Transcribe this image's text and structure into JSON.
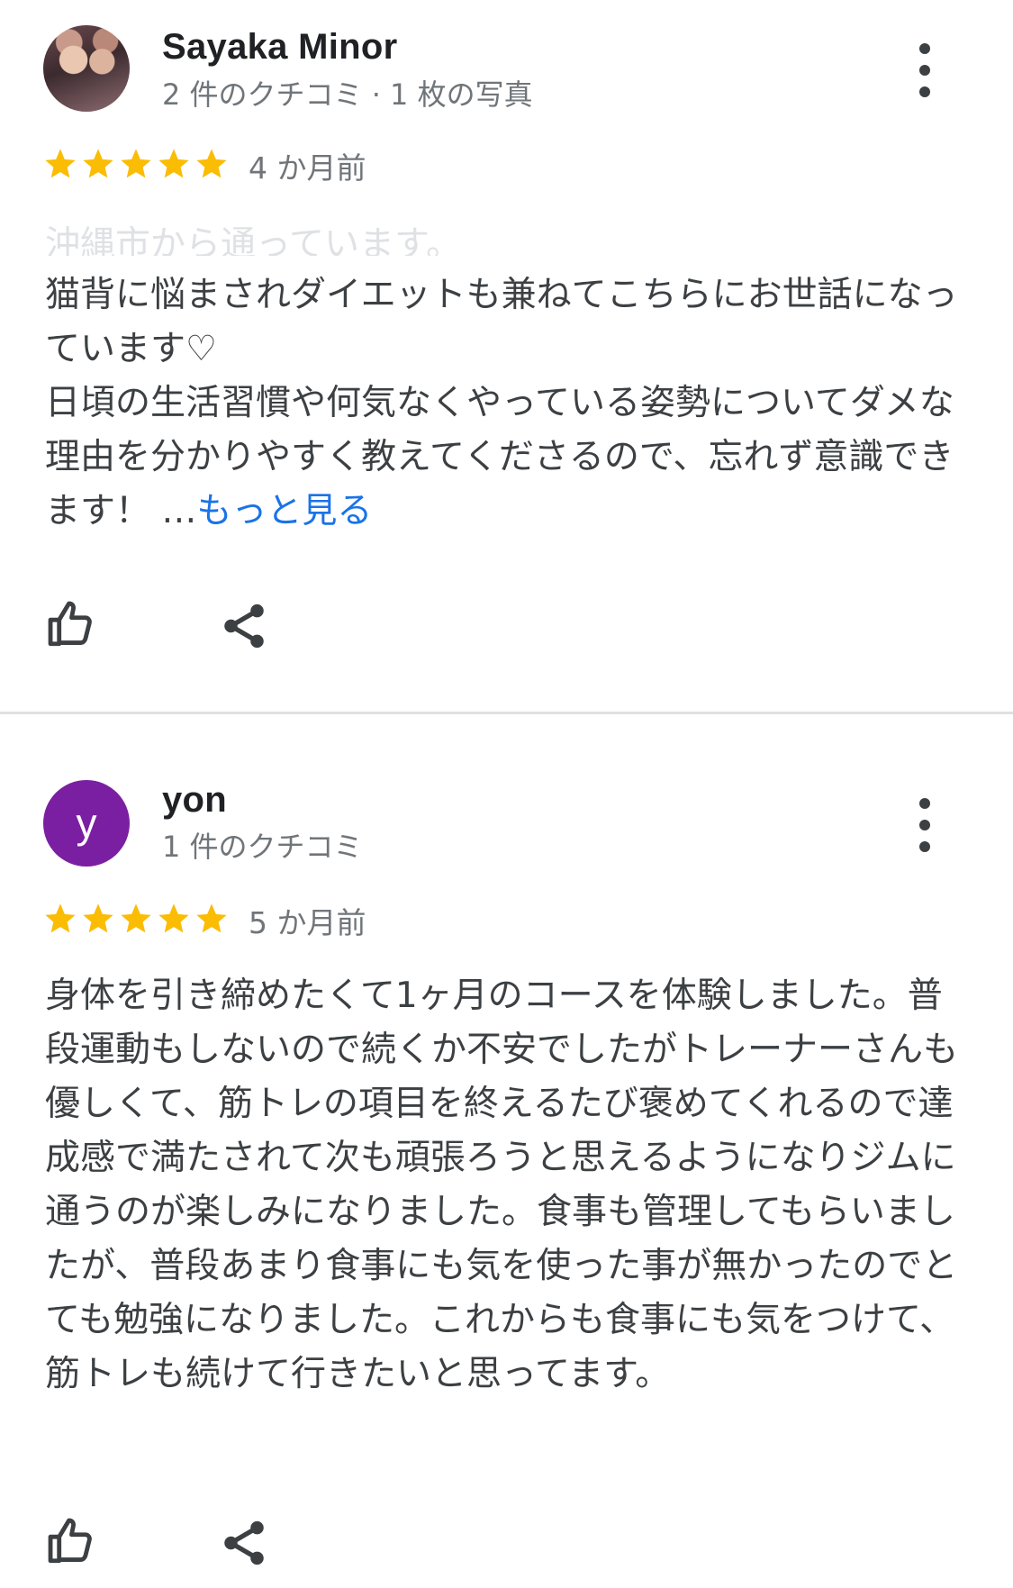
{
  "reviews": [
    {
      "author": "Sayaka Minor",
      "meta": "2 件のクチコミ · 1 枚の写真",
      "rating": 5,
      "age": "4 か月前",
      "faded_line": "沖縄市から通っています。",
      "text": "猫背に悩まされダイエットも兼ねてこちらにお世話になっています♡\n日頃の生活習慣や何気なくやっている姿勢についてダメな理由を分かりやすく教えてくださるので、忘れず意識できます！ …",
      "more_label": "もっと見る"
    },
    {
      "author": "yon",
      "avatar_letter": "y",
      "avatar_color": "#7b1fa2",
      "meta": "1 件のクチコミ",
      "rating": 5,
      "age": "5 か月前",
      "text": "身体を引き締めたくて1ヶ月のコースを体験しました。普段運動もしないので続くか不安でしたがトレーナーさんも優しくて、筋トレの項目を終えるたび褒めてくれるので達成感で満たされて次も頑張ろうと思えるようになりジムに通うのが楽しみになりました。食事も管理してもらいましたが、普段あまり食事にも気を使った事が無かったのでとても勉強になりました。これからも食事にも気をつけて、筋トレも続けて行きたいと思ってます。"
    }
  ],
  "icons": {
    "like": "thumb-up-icon",
    "share": "share-icon",
    "menu": "more-vert-icon",
    "star": "star-icon"
  },
  "colors": {
    "star": "#fbbc04",
    "link": "#1a73e8",
    "meta": "#70757a"
  }
}
